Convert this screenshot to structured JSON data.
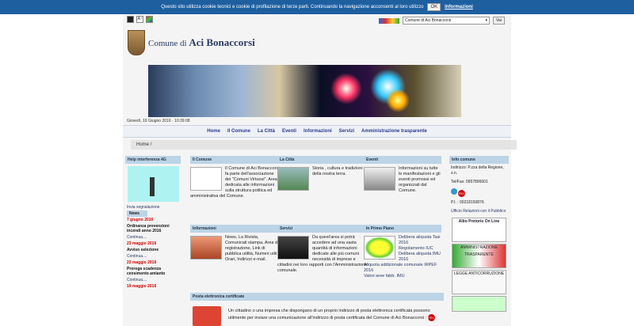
{
  "cookie": {
    "text": "Questo sito utilizza cookie tecnici e cookie di profilazione di terze parti. Continuando la navigazione acconsenti al loro utilizzo",
    "ok": "OK",
    "info": "Informazioni"
  },
  "toolbar": {
    "a": "A",
    "a_plus": "A⁺"
  },
  "search": {
    "selected": "Comune di Aci Bonaccorsi",
    "go": "Vai"
  },
  "brand": {
    "prefix": "Comune di",
    "name": "Aci Bonaccorsi"
  },
  "date": "Giovedì, 16 Giugno 2016 · 10:39:08",
  "nav": [
    "Home",
    "Il Comune",
    "La Città",
    "Eventi",
    "Informazioni",
    "Servizi",
    "Amministrazione trasparente"
  ],
  "breadcrumb": "Home",
  "sidebar": {
    "title": "Help interferenza 4G",
    "caption": "Invia segnalazione",
    "news_label": "News",
    "news": [
      {
        "date": "7 giugno 2016",
        "title": "Ordinanza prevenzioni incendi anno 2016",
        "more": "Continua...."
      },
      {
        "date": "23 maggio 2016",
        "title": "Avviso selezione",
        "more": "Continua...."
      },
      {
        "date": "23 maggio 2016",
        "title": "Proroga scadenza censimento amianto",
        "more": "Continua...."
      },
      {
        "date": "19 maggio 2016",
        "title": "",
        "more": ""
      }
    ]
  },
  "cards": {
    "comune": {
      "title": "Il Comune",
      "text": "Il Comune di Aci Bonaccorsi fa parte dell'associazione dei \"Comuni Virtuosi\". Area dedicata alle informazioni sulla struttura politica ed amministrativa del Comune."
    },
    "citta": {
      "title": "La Città",
      "text": "Storia , cultura e tradizioni della nostra terra."
    },
    "eventi": {
      "title": "Eventi",
      "text": "Informazioni su tutte le manifestazioni e gli eventi promossi ed organizzati dal Comune."
    },
    "info": {
      "title": "Informazioni",
      "text": "News, La Rivista, Comunicati stampa, Area di registrazione, Link di pubblica utilità, Numeri utili, Orari, Indirizzi e-mail."
    },
    "servizi": {
      "title": "Servizi",
      "text": "Da quest'area si potrà accedere ad una vasta quantità di informazioni dedicate alle più comuni necessità di imprese e cittadini nei loro rapporti con l'Amministrazione comunale."
    },
    "primo": {
      "title": "In Primo Piano",
      "l1": "Delibera aliquota Tasi 2016",
      "l2": "Regolamento IUC",
      "l3": "Delibera aliquota IMU 2016",
      "l4": "Aliquota addizionale comunale IRPEF 2016",
      "l5": "Valori aree fabb. IMU"
    }
  },
  "pec": {
    "title": "Posta elettronica certificate",
    "text": "Un cittadino o una impresa che dispongano di un proprio indirizzo di posta elettronica certificata possono utilmente per inviare una comunicazione all'indirizzo di posta certificata del Comune di Aci Bonaccorsi :"
  },
  "right": {
    "title": "Info comune",
    "address": "Indirizzo: P.zza della Regione, s.n.",
    "tel": "Tel/Fax: 0957896601",
    "piva": "P.I. : 00218150876",
    "urp": "Ufficio Relazioni con il Pubblico",
    "albo": "Albo Pretorio On Line",
    "amm": "AMMINISTRAZIONE TRASPARENTE",
    "anticorruzione": "LEGGE ANTICORRUZIONE"
  }
}
